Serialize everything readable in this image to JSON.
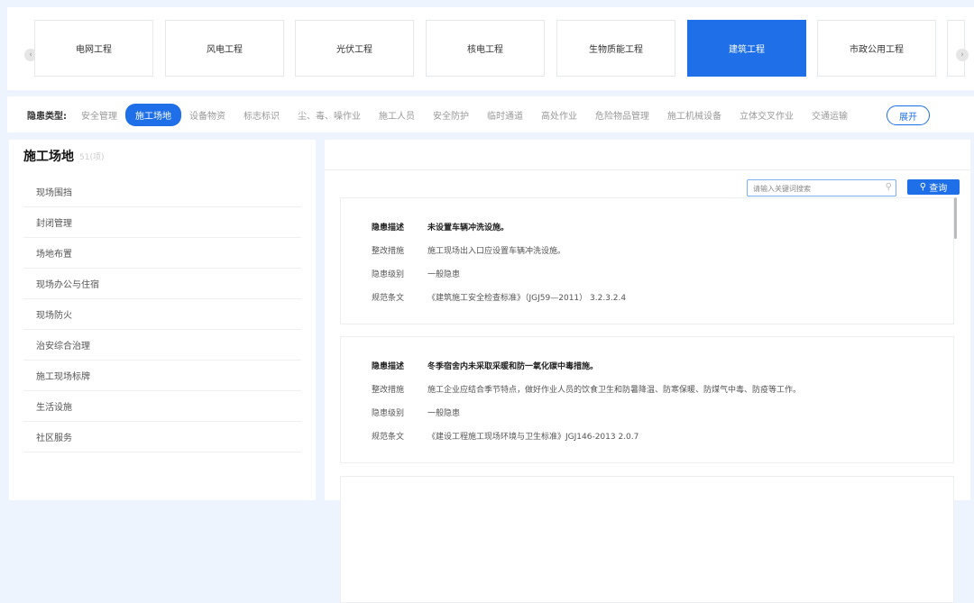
{
  "categories": [
    "电网工程",
    "风电工程",
    "光伏工程",
    "核电工程",
    "生物质能工程",
    "建筑工程",
    "市政公用工程"
  ],
  "filter": {
    "label": "隐患类型:",
    "chips": [
      "安全管理",
      "施工场地",
      "设备物资",
      "标志标识",
      "尘、毒、噪作业",
      "施工人员",
      "安全防护",
      "临时通道",
      "高处作业",
      "危险物品管理",
      "施工机械设备",
      "立体交叉作业",
      "交通运输"
    ],
    "expand": "展开"
  },
  "left": {
    "title": "施工场地",
    "count": "51(项)",
    "items": [
      "现场围挡",
      "封闭管理",
      "场地布置",
      "现场办公与住宿",
      "现场防火",
      "治安综合治理",
      "施工现场标牌",
      "生活设施",
      "社区服务"
    ]
  },
  "search": {
    "placeholder": "请输入关键词搜索",
    "button": "查询"
  },
  "labels": {
    "desc": "隐患描述",
    "fix": "整改措施",
    "level": "隐患级别",
    "std": "规范条文"
  },
  "cards": [
    {
      "desc": "未设置车辆冲洗设施。",
      "fix": "施工现场出入口应设置车辆冲洗设施。",
      "level": "一般隐患",
      "std": "《建筑施工安全检查标准》（JGJ59—2011） 3.2.3.2.4"
    },
    {
      "desc": "冬季宿舍内未采取采暖和防一氧化碳中毒措施。",
      "fix": "施工企业应结合季节特点，做好作业人员的饮食卫生和防暑降温、防寒保暖、防煤气中毒、防疫等工作。",
      "level": "一般隐患",
      "std": "《建设工程施工现场环境与卫生标准》JGJ146-2013 2.0.7"
    }
  ]
}
